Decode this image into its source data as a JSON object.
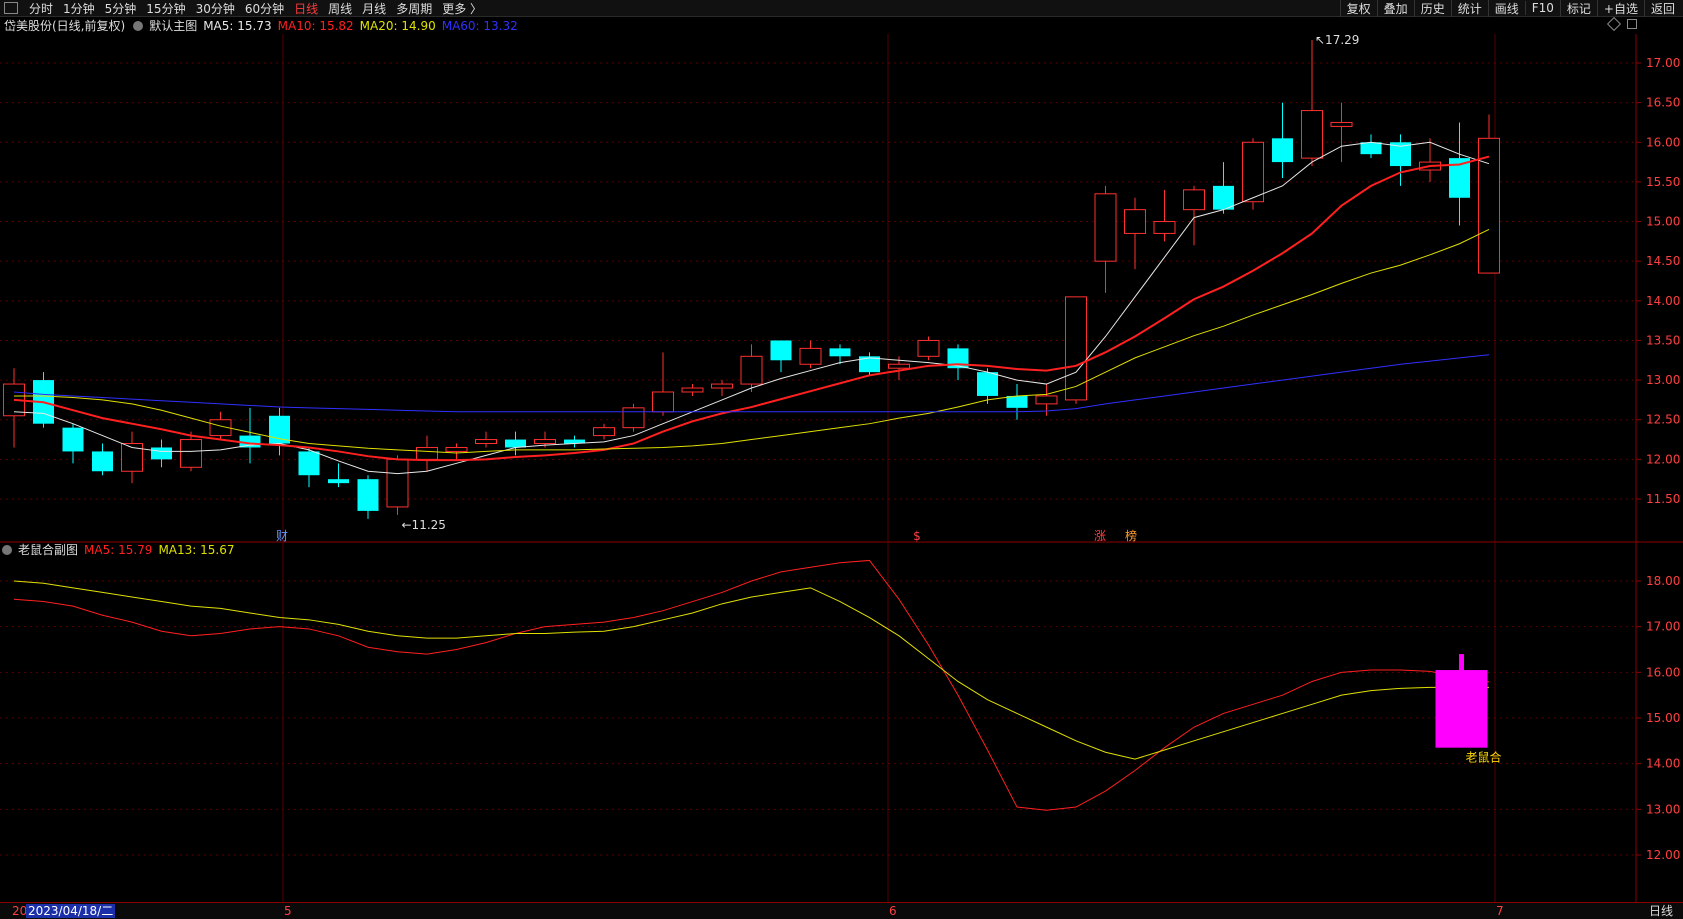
{
  "toolbar": {
    "periods": [
      "分时",
      "1分钟",
      "5分钟",
      "15分钟",
      "30分钟",
      "60分钟",
      "日线",
      "周线",
      "月线",
      "多周期",
      "更多 〉"
    ],
    "active_period": "日线",
    "right_buttons": [
      "复权",
      "叠加",
      "历史",
      "统计",
      "画线",
      "F10",
      "标记",
      "+自选",
      "返回"
    ]
  },
  "main_panel": {
    "title": "岱美股份(日线,前复权)",
    "template": "默认主图",
    "ma": [
      {
        "label": "MA5: 15.73",
        "color": "#e8e8e8"
      },
      {
        "label": "MA10: 15.82",
        "color": "#ff2020"
      },
      {
        "label": "MA20: 14.90",
        "color": "#e0e000"
      },
      {
        "label": "MA60: 13.32",
        "color": "#3030ff"
      }
    ],
    "high_label": "17.29",
    "low_label": "11.25",
    "markers": [
      {
        "text": "财",
        "color": "#6699ff"
      },
      {
        "text": "$",
        "color": "#ff4040"
      },
      {
        "text": "涨",
        "color": "#ff4040"
      },
      {
        "text": "榜",
        "color": "#ff9933"
      }
    ]
  },
  "sub_panel": {
    "title": "老鼠合副图",
    "ma": [
      {
        "label": "MA5: 15.79",
        "color": "#ff2020"
      },
      {
        "label": "MA13: 15.67",
        "color": "#e0e000"
      }
    ],
    "signal_label": "老鼠合"
  },
  "bottom_bar": {
    "date_prefix": "20",
    "date": "2023/04/18/二",
    "month_ticks": [
      "5",
      "6",
      "7"
    ],
    "period_label": "日线"
  },
  "chart_data": [
    {
      "type": "candlestick",
      "title": "岱美股份(日线,前复权)",
      "ylim": [
        11.0,
        17.5
      ],
      "yticks": [
        11.5,
        12.0,
        12.5,
        13.0,
        13.5,
        14.0,
        14.5,
        15.0,
        15.5,
        16.0,
        16.5,
        17.0
      ],
      "up_color": "#ff3030",
      "down_color": "#00ffff",
      "candles": [
        {
          "o": 12.55,
          "c": 12.95,
          "h": 13.15,
          "l": 12.15
        },
        {
          "o": 13.0,
          "c": 12.45,
          "h": 13.1,
          "l": 12.4
        },
        {
          "o": 12.4,
          "c": 12.1,
          "h": 12.45,
          "l": 11.95
        },
        {
          "o": 12.1,
          "c": 11.85,
          "h": 12.2,
          "l": 11.8
        },
        {
          "o": 11.85,
          "c": 12.2,
          "h": 12.35,
          "l": 11.7
        },
        {
          "o": 12.15,
          "c": 12.0,
          "h": 12.25,
          "l": 11.9
        },
        {
          "o": 11.9,
          "c": 12.25,
          "h": 12.35,
          "l": 11.85
        },
        {
          "o": 12.3,
          "c": 12.5,
          "h": 12.6,
          "l": 12.25
        },
        {
          "o": 12.3,
          "c": 12.15,
          "h": 12.65,
          "l": 11.95
        },
        {
          "o": 12.55,
          "c": 12.2,
          "h": 12.65,
          "l": 12.05
        },
        {
          "o": 12.1,
          "c": 11.8,
          "h": 12.15,
          "l": 11.65
        },
        {
          "o": 11.75,
          "c": 11.7,
          "h": 11.95,
          "l": 11.65
        },
        {
          "o": 11.75,
          "c": 11.35,
          "h": 11.8,
          "l": 11.25
        },
        {
          "o": 11.4,
          "c": 12.0,
          "h": 12.05,
          "l": 11.3
        },
        {
          "o": 12.0,
          "c": 12.15,
          "h": 12.3,
          "l": 11.85
        },
        {
          "o": 12.1,
          "c": 12.15,
          "h": 12.2,
          "l": 12.0
        },
        {
          "o": 12.2,
          "c": 12.25,
          "h": 12.35,
          "l": 12.15
        },
        {
          "o": 12.25,
          "c": 12.15,
          "h": 12.35,
          "l": 12.05
        },
        {
          "o": 12.2,
          "c": 12.25,
          "h": 12.35,
          "l": 12.15
        },
        {
          "o": 12.25,
          "c": 12.2,
          "h": 12.3,
          "l": 12.15
        },
        {
          "o": 12.3,
          "c": 12.4,
          "h": 12.45,
          "l": 12.25
        },
        {
          "o": 12.4,
          "c": 12.65,
          "h": 12.7,
          "l": 12.35
        },
        {
          "o": 12.6,
          "c": 12.85,
          "h": 13.35,
          "l": 12.55
        },
        {
          "o": 12.85,
          "c": 12.9,
          "h": 12.95,
          "l": 12.8
        },
        {
          "o": 12.9,
          "c": 12.95,
          "h": 13.0,
          "l": 12.8
        },
        {
          "o": 12.95,
          "c": 13.3,
          "h": 13.45,
          "l": 12.85
        },
        {
          "o": 13.5,
          "c": 13.25,
          "h": 13.5,
          "l": 13.1
        },
        {
          "o": 13.2,
          "c": 13.4,
          "h": 13.5,
          "l": 13.15
        },
        {
          "o": 13.4,
          "c": 13.3,
          "h": 13.45,
          "l": 13.2
        },
        {
          "o": 13.3,
          "c": 13.1,
          "h": 13.35,
          "l": 13.05
        },
        {
          "o": 13.15,
          "c": 13.2,
          "h": 13.3,
          "l": 13.0
        },
        {
          "o": 13.3,
          "c": 13.5,
          "h": 13.55,
          "l": 13.25
        },
        {
          "o": 13.4,
          "c": 13.15,
          "h": 13.45,
          "l": 13.0
        },
        {
          "o": 13.1,
          "c": 12.8,
          "h": 13.15,
          "l": 12.7
        },
        {
          "o": 12.8,
          "c": 12.65,
          "h": 12.95,
          "l": 12.5
        },
        {
          "o": 12.7,
          "c": 12.8,
          "h": 12.95,
          "l": 12.55
        },
        {
          "o": 12.75,
          "c": 14.05,
          "h": 14.05,
          "l": 12.7
        },
        {
          "o": 14.5,
          "c": 15.35,
          "h": 15.45,
          "l": 14.1
        },
        {
          "o": 14.85,
          "c": 15.15,
          "h": 15.3,
          "l": 14.4
        },
        {
          "o": 14.85,
          "c": 15.0,
          "h": 15.4,
          "l": 14.75
        },
        {
          "o": 15.15,
          "c": 15.4,
          "h": 15.45,
          "l": 14.7
        },
        {
          "o": 15.45,
          "c": 15.15,
          "h": 15.75,
          "l": 15.1
        },
        {
          "o": 15.25,
          "c": 16.0,
          "h": 16.05,
          "l": 15.15
        },
        {
          "o": 16.05,
          "c": 15.75,
          "h": 16.5,
          "l": 15.55
        },
        {
          "o": 15.8,
          "c": 16.4,
          "h": 17.29,
          "l": 15.7
        },
        {
          "o": 16.2,
          "c": 16.25,
          "h": 16.5,
          "l": 15.75
        },
        {
          "o": 16.0,
          "c": 15.85,
          "h": 16.1,
          "l": 15.8
        },
        {
          "o": 16.0,
          "c": 15.7,
          "h": 16.1,
          "l": 15.45
        },
        {
          "o": 15.65,
          "c": 15.75,
          "h": 16.05,
          "l": 15.5
        },
        {
          "o": 15.8,
          "c": 15.3,
          "h": 16.25,
          "l": 14.95
        },
        {
          "o": 14.35,
          "c": 16.05,
          "h": 16.35,
          "l": 14.35
        }
      ],
      "series": [
        {
          "name": "MA5",
          "color": "#e8e8e8",
          "values": [
            12.6,
            12.58,
            12.45,
            12.3,
            12.15,
            12.1,
            12.1,
            12.12,
            12.18,
            12.2,
            12.12,
            11.98,
            11.85,
            11.82,
            11.85,
            11.95,
            12.05,
            12.15,
            12.18,
            12.2,
            12.22,
            12.3,
            12.45,
            12.6,
            12.75,
            12.9,
            13.02,
            13.12,
            13.22,
            13.28,
            13.25,
            13.22,
            13.18,
            13.1,
            13.0,
            12.95,
            13.1,
            13.55,
            14.05,
            14.55,
            15.05,
            15.15,
            15.3,
            15.45,
            15.75,
            15.95,
            16.0,
            15.95,
            16.0,
            15.85,
            15.73
          ]
        },
        {
          "name": "MA10",
          "color": "#ff2020",
          "values": [
            12.75,
            12.72,
            12.62,
            12.52,
            12.45,
            12.38,
            12.3,
            12.25,
            12.2,
            12.18,
            12.15,
            12.1,
            12.04,
            12.0,
            11.99,
            11.99,
            12.0,
            12.03,
            12.05,
            12.08,
            12.12,
            12.2,
            12.35,
            12.48,
            12.58,
            12.66,
            12.76,
            12.86,
            12.96,
            13.06,
            13.12,
            13.18,
            13.2,
            13.18,
            13.14,
            13.12,
            13.18,
            13.35,
            13.55,
            13.78,
            14.02,
            14.18,
            14.38,
            14.6,
            14.85,
            15.2,
            15.45,
            15.62,
            15.7,
            15.72,
            15.82
          ]
        },
        {
          "name": "MA20",
          "color": "#e0e000",
          "values": [
            12.8,
            12.8,
            12.78,
            12.75,
            12.7,
            12.62,
            12.52,
            12.42,
            12.34,
            12.26,
            12.2,
            12.17,
            12.14,
            12.12,
            12.1,
            12.08,
            12.1,
            12.12,
            12.12,
            12.12,
            12.13,
            12.14,
            12.15,
            12.17,
            12.2,
            12.25,
            12.3,
            12.35,
            12.4,
            12.45,
            12.52,
            12.58,
            12.66,
            12.75,
            12.8,
            12.82,
            12.92,
            13.1,
            13.28,
            13.42,
            13.56,
            13.68,
            13.82,
            13.95,
            14.08,
            14.22,
            14.35,
            14.45,
            14.58,
            14.72,
            14.9
          ]
        },
        {
          "name": "MA60",
          "color": "#3030ff",
          "values": [
            12.85,
            12.82,
            12.8,
            12.78,
            12.76,
            12.74,
            12.72,
            12.7,
            12.68,
            12.66,
            12.65,
            12.64,
            12.63,
            12.62,
            12.61,
            12.6,
            12.6,
            12.6,
            12.6,
            12.6,
            12.6,
            12.6,
            12.6,
            12.6,
            12.6,
            12.6,
            12.6,
            12.6,
            12.6,
            12.6,
            12.6,
            12.6,
            12.6,
            12.6,
            12.6,
            12.61,
            12.64,
            12.7,
            12.75,
            12.8,
            12.85,
            12.9,
            12.95,
            13.0,
            13.05,
            13.1,
            13.15,
            13.2,
            13.24,
            13.28,
            13.32
          ]
        }
      ]
    },
    {
      "type": "line",
      "title": "老鼠合副图",
      "ylim": [
        11.2,
        19.0
      ],
      "yticks": [
        12.0,
        13.0,
        14.0,
        15.0,
        16.0,
        17.0,
        18.0
      ],
      "series": [
        {
          "name": "MA5",
          "color": "#ff2020",
          "values": [
            17.6,
            17.55,
            17.45,
            17.25,
            17.1,
            16.9,
            16.8,
            16.85,
            16.95,
            17.0,
            16.95,
            16.8,
            16.55,
            16.45,
            16.4,
            16.5,
            16.65,
            16.85,
            17.0,
            17.05,
            17.1,
            17.2,
            17.35,
            17.55,
            17.75,
            18.0,
            18.2,
            18.3,
            18.4,
            18.45,
            17.6,
            16.6,
            15.5,
            14.3,
            13.05,
            12.98,
            13.05,
            13.4,
            13.85,
            14.35,
            14.8,
            15.1,
            15.3,
            15.5,
            15.8,
            16.0,
            16.05,
            16.05,
            16.02,
            15.9,
            15.79
          ]
        },
        {
          "name": "MA13",
          "color": "#e0e000",
          "values": [
            18.0,
            17.95,
            17.85,
            17.75,
            17.65,
            17.55,
            17.45,
            17.4,
            17.3,
            17.2,
            17.15,
            17.05,
            16.9,
            16.8,
            16.75,
            16.75,
            16.8,
            16.85,
            16.85,
            16.88,
            16.9,
            17.0,
            17.15,
            17.3,
            17.5,
            17.65,
            17.75,
            17.85,
            17.55,
            17.2,
            16.8,
            16.3,
            15.8,
            15.4,
            15.1,
            14.8,
            14.5,
            14.25,
            14.1,
            14.3,
            14.5,
            14.7,
            14.9,
            15.1,
            15.3,
            15.5,
            15.6,
            15.65,
            15.67,
            15.67,
            15.67
          ]
        }
      ],
      "signal_bar": {
        "index": 49,
        "top": 16.05,
        "bottom": 14.35,
        "wick_top": 16.4,
        "color": "#ff00ff"
      }
    }
  ]
}
